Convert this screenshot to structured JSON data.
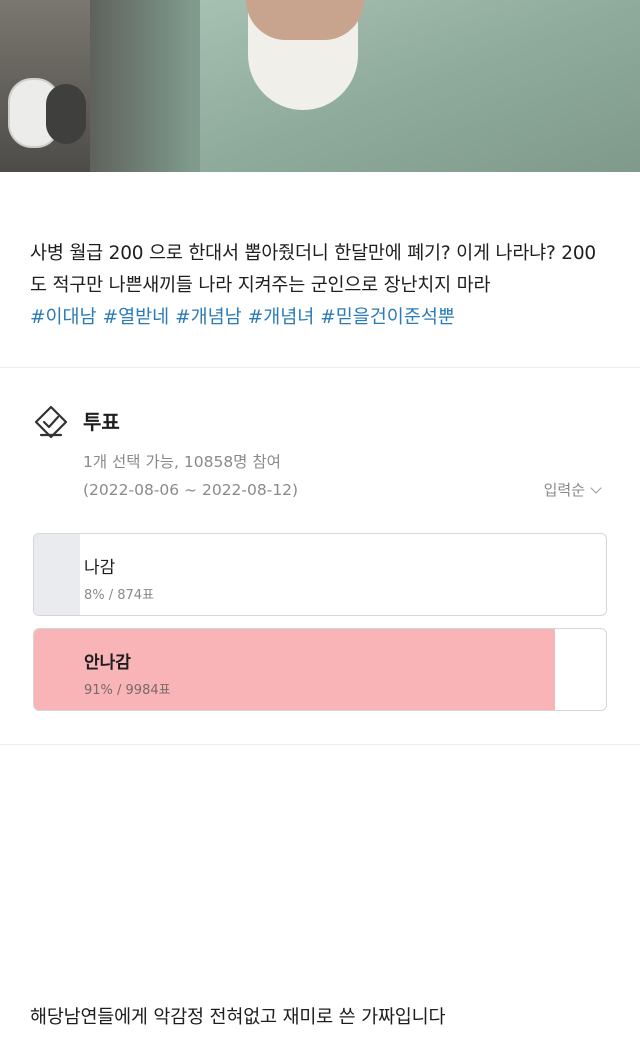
{
  "post": {
    "body": "사병 월급 200 으로 한대서 뽑아줬더니 한달만에 폐기? 이게 나라냐? 200도 적구만 나쁜새끼들 나라 지켜주는 군인으로 장난치지 마라",
    "hashtags": [
      "#이대남",
      "#열받네",
      "#개념남",
      "#개념녀",
      "#믿을건이준석뿐"
    ]
  },
  "vote": {
    "icon": "vote-check-icon",
    "title": "투표",
    "meta": "1개 선택 가능, 10858명 참여",
    "period": "(2022-08-06 ~ 2022-08-12)",
    "sort_label": "입력순",
    "options": [
      {
        "label": "나감",
        "stat": "8% / 874표",
        "percent": 8,
        "fill_color": "#e9ebee",
        "selected": false
      },
      {
        "label": "안나감",
        "stat": "91% / 9984표",
        "percent": 91,
        "fill_color": "#f8b4b6",
        "selected": true
      }
    ]
  },
  "footer": {
    "note": "해당남연들에게 악감정 전혀없고 재미로 쓴 가짜입니다"
  }
}
